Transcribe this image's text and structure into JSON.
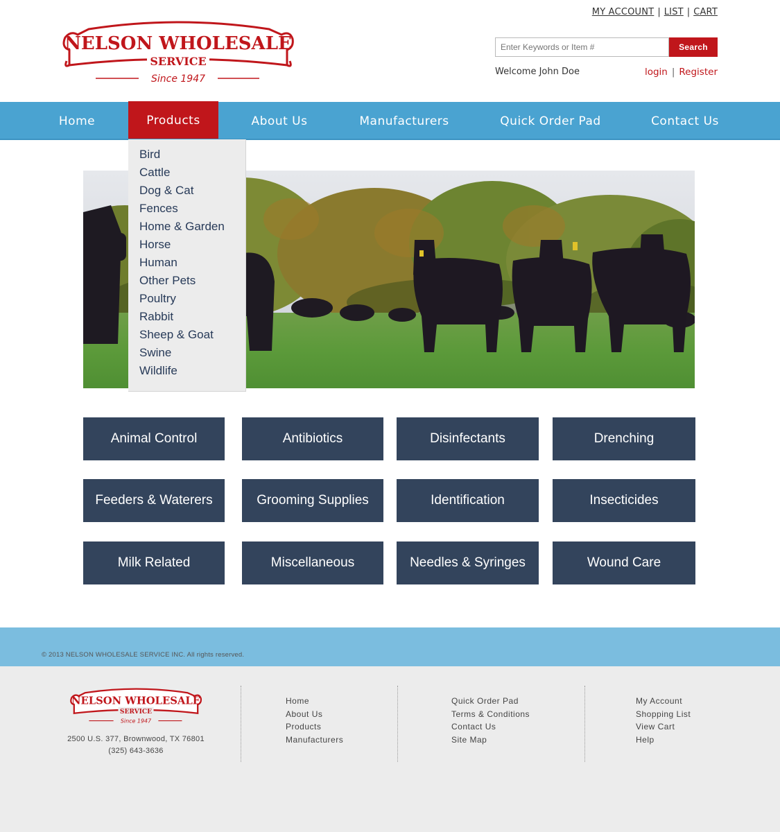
{
  "header": {
    "logo": {
      "line1": "NELSON WHOLESALE",
      "line2": "SERVICE",
      "tagline": "Since 1947"
    },
    "top_links": [
      "MY ACCOUNT",
      "LIST",
      "CART"
    ],
    "search": {
      "placeholder": "Enter Keywords or Item #",
      "button": "Search"
    },
    "welcome": "Welcome John Doe",
    "login": "login",
    "register": "Register"
  },
  "nav": {
    "items": [
      "Home",
      "Products",
      "About Us",
      "Manufacturers",
      "Quick Order Pad",
      "Contact Us"
    ],
    "active": "Products"
  },
  "products_menu": [
    "Bird",
    "Cattle",
    "Dog & Cat",
    "Fences",
    "Home & Garden",
    "Horse",
    "Human",
    "Other Pets",
    "Poultry",
    "Rabbit",
    "Sheep & Goat",
    "Swine",
    "Wildlife"
  ],
  "categories": [
    "Animal Control",
    "Antibiotics",
    "Disinfectants",
    "Drenching",
    "Feeders & Waterers",
    "Grooming Supplies",
    "Identification",
    "Insecticides",
    "Milk Related",
    "Miscellaneous",
    "Needles & Syringes",
    "Wound Care"
  ],
  "colors": {
    "brand_red": "#c0161b",
    "nav_blue": "#4aa3d1",
    "tile_navy": "#33445c",
    "footer_band": "#7bbddf"
  },
  "footer": {
    "copyright": "© 2013 NELSON WHOLESALE SERVICE INC. All rights reserved.",
    "address": "2500 U.S. 377, Brownwood, TX 76801",
    "phone": "(325) 643-3636",
    "col1": [
      "Home",
      "About Us",
      "Products",
      "Manufacturers"
    ],
    "col2": [
      "Quick Order Pad",
      "Terms & Conditions",
      "Contact Us",
      "Site Map"
    ],
    "col3": [
      "My Account",
      "Shopping List",
      "View Cart",
      "Help"
    ]
  }
}
